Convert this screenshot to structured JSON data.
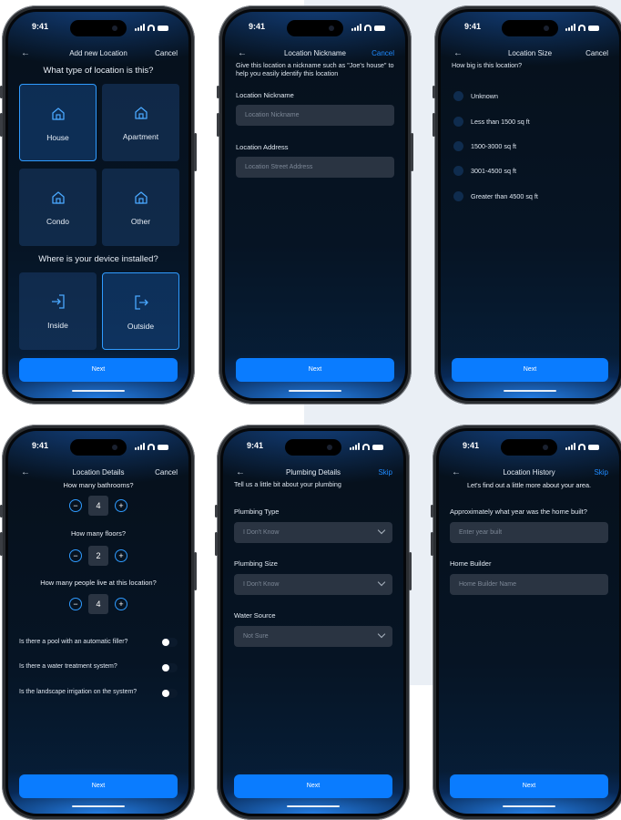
{
  "status_time": "9:41",
  "next_label": "Next",
  "s1": {
    "title": "Add new  Location",
    "cancel": "Cancel",
    "q1": "What type of location is this?",
    "types": [
      "House",
      "Apartment",
      "Condo",
      "Other"
    ],
    "q2": "Where is your device installed?",
    "install": [
      "Inside",
      "Outside"
    ]
  },
  "s2": {
    "title": "Location Nickname",
    "cancel": "Cancel",
    "intro": "Give this location a nickname such as \"Joe's house\" to help you easily identify this location",
    "nick_label": "Location Nickname",
    "nick_placeholder": "Location Nickname",
    "addr_label": "Location Address",
    "addr_placeholder": "Location Street Address"
  },
  "s3": {
    "title": "Location Size",
    "cancel": "Cancel",
    "question": "How big is this location?",
    "options": [
      "Unknown",
      "Less than 1500 sq ft",
      "1500-3000 sq ft",
      "3001-4500 sq ft",
      "Greater than 4500 sq ft"
    ]
  },
  "s4": {
    "title": "Location Details",
    "cancel": "Cancel",
    "q_bath": "How many bathrooms?",
    "bath": "4",
    "q_floors": "How many floors?",
    "floors": "2",
    "q_people": "How many people live at this location?",
    "people": "4",
    "minus": "−",
    "plus": "+",
    "toggles": [
      "Is there a pool with an automatic filler?",
      "Is there a water treatment system?",
      "Is the landscape irrigation on the system?"
    ]
  },
  "s5": {
    "title": "Plumbing Details",
    "skip": "Skip",
    "intro": "Tell us a little bit about your plumbing",
    "type_label": "Plumbing Type",
    "type_value": "I Don't Know",
    "size_label": "Plumbing Size",
    "size_value": "I Don't Know",
    "water_label": "Water Source",
    "water_value": "Not Sure"
  },
  "s6": {
    "title": "Location History",
    "skip": "Skip",
    "intro": "Let's find out a little more about your area.",
    "year_label": "Approximately what year was the home built?",
    "year_placeholder": "Enter year built",
    "builder_label": "Home Builder",
    "builder_placeholder": "Home Builder Name"
  },
  "colors": {
    "accent": "#0a7cff",
    "link": "#1f8bff",
    "field": "#2a3442",
    "background": "#061424"
  }
}
